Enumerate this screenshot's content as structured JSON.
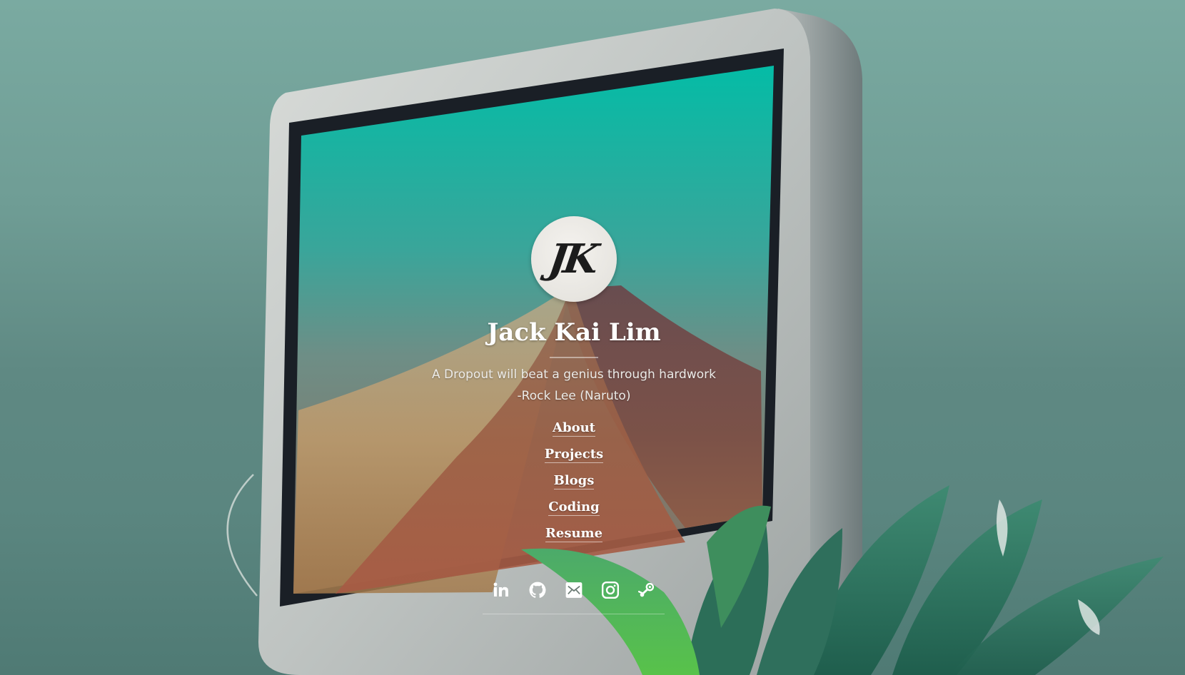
{
  "profile": {
    "avatar_monogram": "JK",
    "name": "Jack Kai Lim",
    "tagline": "A Dropout will beat a genius through hardwork -Rock Lee (Naruto)"
  },
  "nav": {
    "items": [
      {
        "label": "About"
      },
      {
        "label": "Projects"
      },
      {
        "label": "Blogs"
      },
      {
        "label": "Coding"
      },
      {
        "label": "Resume"
      }
    ]
  },
  "social": {
    "icons": [
      "linkedin-icon",
      "github-icon",
      "email-icon",
      "instagram-icon",
      "steam-icon"
    ]
  },
  "colors": {
    "background": "#6f9d95",
    "text": "#ffffff",
    "screen_teal": "#0abaa5",
    "mountain_orange": "#b26a48"
  }
}
